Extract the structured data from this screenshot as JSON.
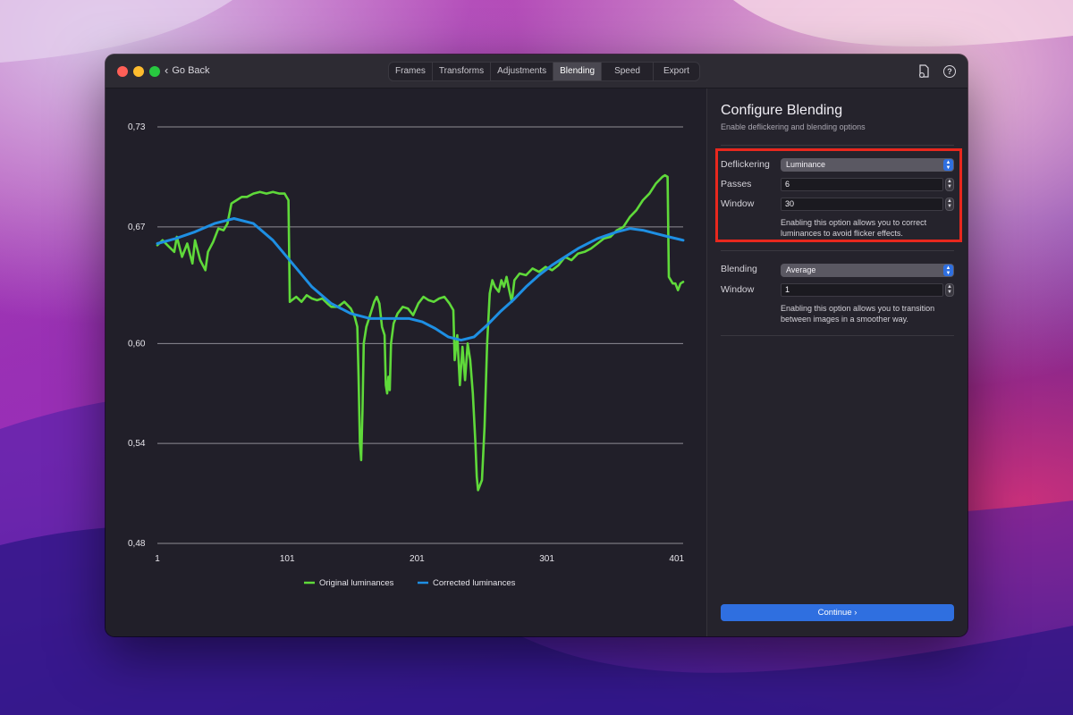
{
  "titlebar": {
    "back_label": "Go Back",
    "tabs": [
      {
        "label": "Frames",
        "active": false
      },
      {
        "label": "Transforms",
        "active": false
      },
      {
        "label": "Adjustments",
        "active": false
      },
      {
        "label": "Blending",
        "active": true
      },
      {
        "label": "Speed",
        "active": false
      },
      {
        "label": "Export",
        "active": false
      }
    ],
    "icons": [
      "document-badge-icon",
      "help-icon"
    ],
    "help_glyph": "?"
  },
  "sidebar": {
    "title": "Configure Blending",
    "subtitle": "Enable deflickering and blending options",
    "deflicker": {
      "label": "Deflickering",
      "value": "Luminance",
      "passes_label": "Passes",
      "passes_value": "6",
      "window_label": "Window",
      "window_value": "30",
      "help": "Enabling this option allows you to correct luminances to avoid flicker effects."
    },
    "blending": {
      "label": "Blending",
      "value": "Average",
      "window_label": "Window",
      "window_value": "1",
      "help": "Enabling this option allows you to transition between images in a smoother way."
    },
    "continue_label": "Continue ›",
    "accent_color": "#2f6fe0",
    "highlight_color": "#e8281e"
  },
  "chart_data": {
    "type": "line",
    "x_ticks": [
      1,
      101,
      201,
      301,
      401
    ],
    "y_ticks": [
      "0,73",
      "0,67",
      "0,60",
      "0,54",
      "0,48"
    ],
    "y_tick_values": [
      0.73,
      0.67,
      0.6,
      0.54,
      0.48
    ],
    "xlim": [
      1,
      406
    ],
    "ylim": [
      0.48,
      0.73
    ],
    "grid": true,
    "legend_placement": "bottom-center",
    "series": [
      {
        "name": "Original luminances",
        "color": "#5fd93a",
        "points": [
          [
            1,
            0.659
          ],
          [
            5,
            0.662
          ],
          [
            10,
            0.658
          ],
          [
            14,
            0.655
          ],
          [
            16,
            0.664
          ],
          [
            20,
            0.652
          ],
          [
            24,
            0.66
          ],
          [
            28,
            0.648
          ],
          [
            30,
            0.662
          ],
          [
            34,
            0.65
          ],
          [
            38,
            0.644
          ],
          [
            40,
            0.655
          ],
          [
            44,
            0.661
          ],
          [
            48,
            0.669
          ],
          [
            52,
            0.668
          ],
          [
            55,
            0.672
          ],
          [
            58,
            0.684
          ],
          [
            62,
            0.686
          ],
          [
            66,
            0.688
          ],
          [
            70,
            0.688
          ],
          [
            75,
            0.69
          ],
          [
            80,
            0.691
          ],
          [
            85,
            0.69
          ],
          [
            90,
            0.691
          ],
          [
            95,
            0.69
          ],
          [
            99,
            0.69
          ],
          [
            102,
            0.686
          ],
          [
            103,
            0.625
          ],
          [
            108,
            0.628
          ],
          [
            112,
            0.625
          ],
          [
            116,
            0.629
          ],
          [
            120,
            0.627
          ],
          [
            124,
            0.626
          ],
          [
            128,
            0.627
          ],
          [
            132,
            0.624
          ],
          [
            135,
            0.622
          ],
          [
            140,
            0.622
          ],
          [
            145,
            0.625
          ],
          [
            150,
            0.621
          ],
          [
            153,
            0.616
          ],
          [
            155,
            0.61
          ],
          [
            156,
            0.58
          ],
          [
            157,
            0.54
          ],
          [
            158,
            0.53
          ],
          [
            159,
            0.56
          ],
          [
            160,
            0.6
          ],
          [
            162,
            0.61
          ],
          [
            164,
            0.615
          ],
          [
            166,
            0.62
          ],
          [
            168,
            0.625
          ],
          [
            170,
            0.628
          ],
          [
            172,
            0.624
          ],
          [
            174,
            0.61
          ],
          [
            176,
            0.605
          ],
          [
            177,
            0.575
          ],
          [
            178,
            0.57
          ],
          [
            179,
            0.58
          ],
          [
            180,
            0.572
          ],
          [
            181,
            0.6
          ],
          [
            183,
            0.612
          ],
          [
            186,
            0.618
          ],
          [
            190,
            0.622
          ],
          [
            194,
            0.621
          ],
          [
            198,
            0.617
          ],
          [
            202,
            0.624
          ],
          [
            206,
            0.628
          ],
          [
            210,
            0.626
          ],
          [
            214,
            0.625
          ],
          [
            218,
            0.627
          ],
          [
            222,
            0.628
          ],
          [
            226,
            0.624
          ],
          [
            229,
            0.62
          ],
          [
            230,
            0.59
          ],
          [
            232,
            0.605
          ],
          [
            234,
            0.575
          ],
          [
            236,
            0.598
          ],
          [
            238,
            0.578
          ],
          [
            240,
            0.6
          ],
          [
            242,
            0.59
          ],
          [
            244,
            0.57
          ],
          [
            246,
            0.54
          ],
          [
            247,
            0.52
          ],
          [
            248,
            0.512
          ],
          [
            249,
            0.514
          ],
          [
            251,
            0.518
          ],
          [
            253,
            0.55
          ],
          [
            255,
            0.6
          ],
          [
            257,
            0.63
          ],
          [
            259,
            0.638
          ],
          [
            261,
            0.634
          ],
          [
            264,
            0.631
          ],
          [
            266,
            0.638
          ],
          [
            268,
            0.634
          ],
          [
            270,
            0.64
          ],
          [
            272,
            0.632
          ],
          [
            274,
            0.625
          ],
          [
            276,
            0.638
          ],
          [
            280,
            0.642
          ],
          [
            285,
            0.641
          ],
          [
            290,
            0.645
          ],
          [
            295,
            0.643
          ],
          [
            300,
            0.646
          ],
          [
            305,
            0.644
          ],
          [
            310,
            0.647
          ],
          [
            315,
            0.652
          ],
          [
            320,
            0.65
          ],
          [
            325,
            0.654
          ],
          [
            330,
            0.655
          ],
          [
            335,
            0.657
          ],
          [
            340,
            0.66
          ],
          [
            345,
            0.663
          ],
          [
            350,
            0.664
          ],
          [
            355,
            0.668
          ],
          [
            360,
            0.67
          ],
          [
            365,
            0.676
          ],
          [
            370,
            0.68
          ],
          [
            375,
            0.686
          ],
          [
            380,
            0.69
          ],
          [
            385,
            0.696
          ],
          [
            390,
            0.7
          ],
          [
            392,
            0.701
          ],
          [
            394,
            0.7
          ],
          [
            395,
            0.64
          ],
          [
            398,
            0.636
          ],
          [
            400,
            0.636
          ],
          [
            402,
            0.632
          ],
          [
            404,
            0.636
          ],
          [
            406,
            0.637
          ]
        ]
      },
      {
        "name": "Corrected luminances",
        "color": "#1e8fe3",
        "points": [
          [
            1,
            0.66
          ],
          [
            15,
            0.663
          ],
          [
            30,
            0.667
          ],
          [
            45,
            0.672
          ],
          [
            60,
            0.675
          ],
          [
            75,
            0.672
          ],
          [
            90,
            0.662
          ],
          [
            105,
            0.648
          ],
          [
            120,
            0.634
          ],
          [
            135,
            0.624
          ],
          [
            150,
            0.618
          ],
          [
            165,
            0.615
          ],
          [
            180,
            0.615
          ],
          [
            195,
            0.615
          ],
          [
            205,
            0.613
          ],
          [
            215,
            0.609
          ],
          [
            225,
            0.604
          ],
          [
            235,
            0.602
          ],
          [
            245,
            0.604
          ],
          [
            255,
            0.611
          ],
          [
            265,
            0.619
          ],
          [
            275,
            0.626
          ],
          [
            285,
            0.634
          ],
          [
            295,
            0.641
          ],
          [
            305,
            0.647
          ],
          [
            315,
            0.652
          ],
          [
            325,
            0.657
          ],
          [
            340,
            0.663
          ],
          [
            355,
            0.667
          ],
          [
            365,
            0.669
          ],
          [
            375,
            0.668
          ],
          [
            385,
            0.666
          ],
          [
            395,
            0.664
          ],
          [
            406,
            0.662
          ]
        ]
      }
    ]
  }
}
